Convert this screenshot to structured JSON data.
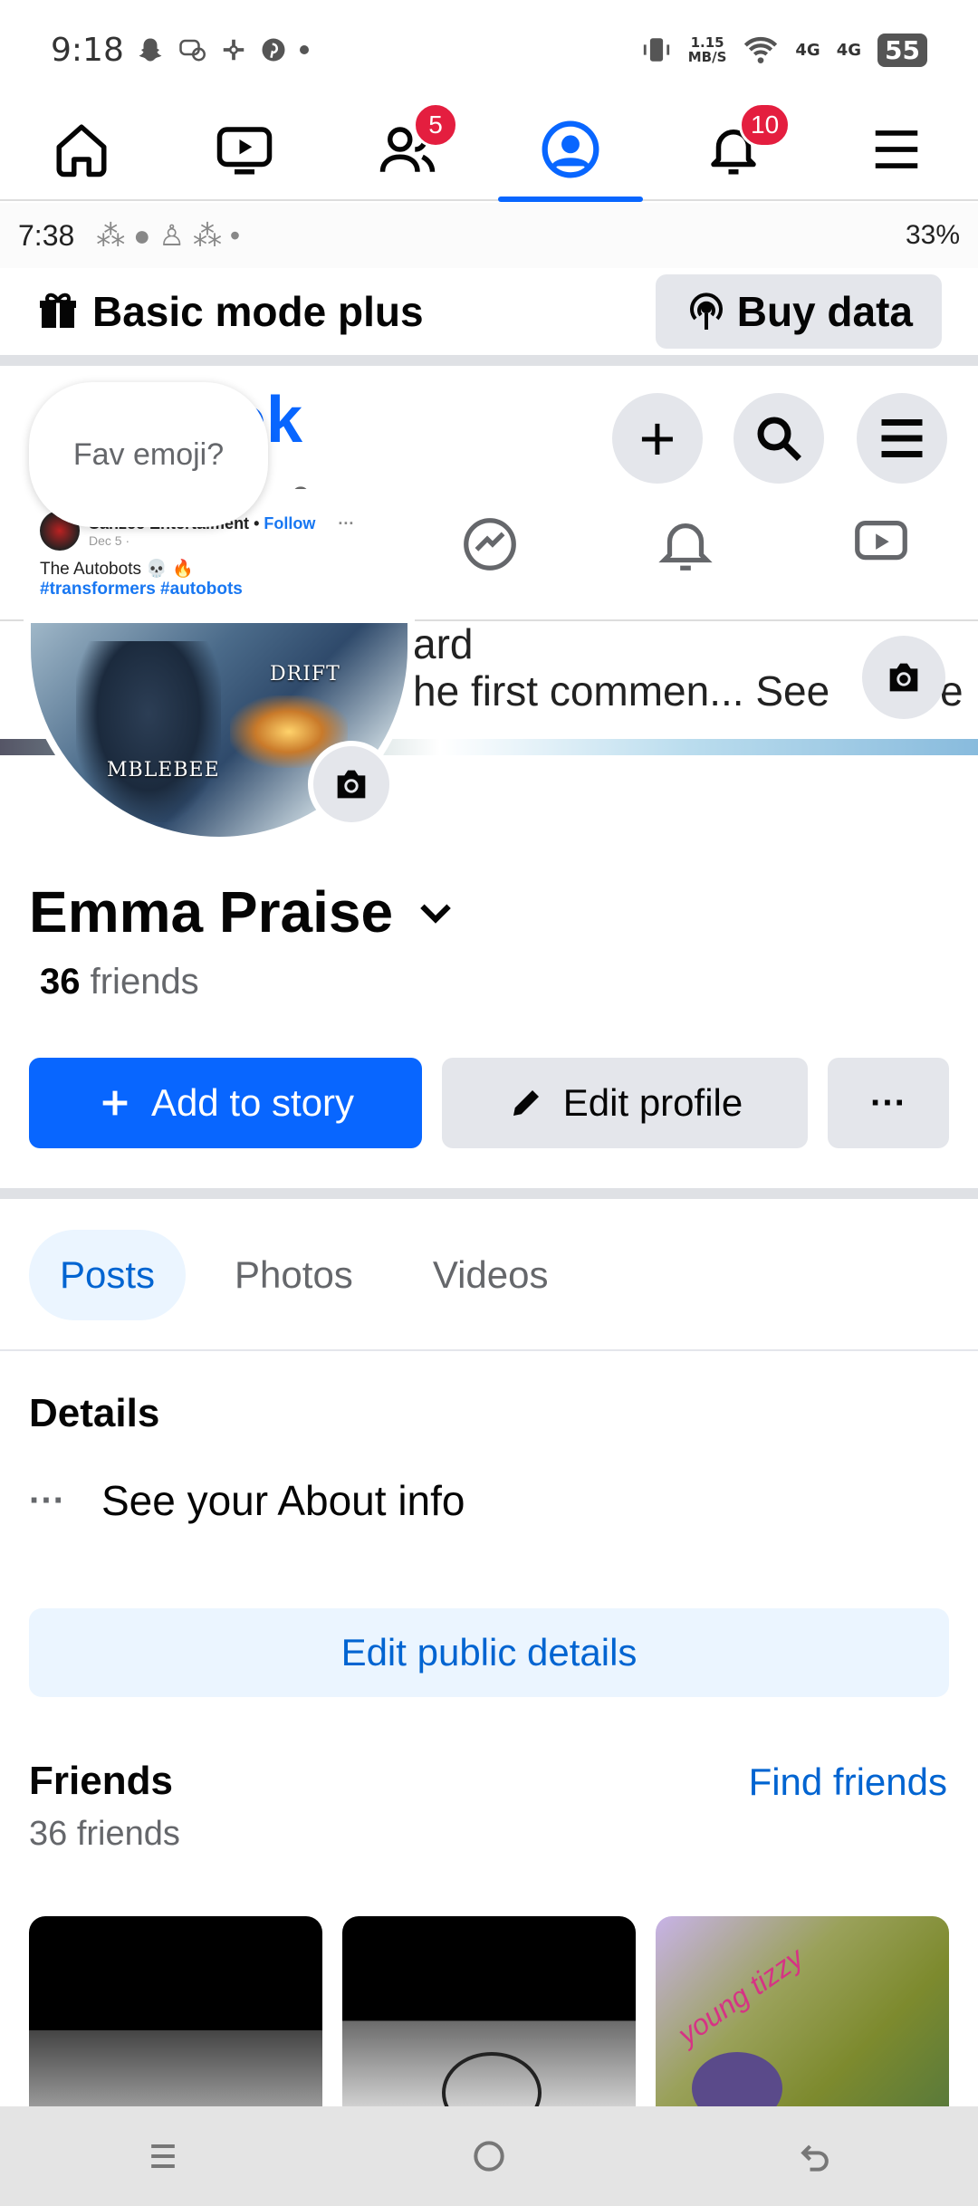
{
  "status_bar": {
    "time": "9:18",
    "net_speed": "1.15",
    "net_unit": "MB/S",
    "sig1": "4G",
    "sig2": "4G",
    "battery": "55"
  },
  "nav": {
    "items": [
      {
        "name": "home",
        "badge": ""
      },
      {
        "name": "video",
        "badge": ""
      },
      {
        "name": "friends",
        "badge": "5"
      },
      {
        "name": "profile",
        "badge": ""
      },
      {
        "name": "notifications",
        "badge": "10"
      },
      {
        "name": "menu",
        "badge": ""
      }
    ]
  },
  "story": {
    "inner_time": "7:38",
    "inner_battery": "33%",
    "basic_mode": "Basic mode plus",
    "buy_data": "Buy data",
    "logo_fragment": "ok",
    "bubble": "Fav emoji?",
    "post_author": "Sanzee Entertaiment",
    "post_follow": "Follow",
    "post_date": "Dec 5 ·",
    "post_text": "The Autobots 💀 🔥",
    "post_tags": "#transformers #autobots",
    "art_label1": "DRIFT",
    "art_label2": "MBLEBEE",
    "cover_line1": "ard",
    "cover_line2": "he first commen... See",
    "cover_tail": "e"
  },
  "profile": {
    "name": "Emma Praise",
    "friends_count": "36",
    "friends_label": "friends"
  },
  "actions": {
    "add_story": "Add to story",
    "edit_profile": "Edit profile",
    "more": "···"
  },
  "tabs": [
    "Posts",
    "Photos",
    "Videos"
  ],
  "details": {
    "title": "Details",
    "about": "See your About info",
    "edit_public": "Edit public details"
  },
  "friends": {
    "title": "Friends",
    "find": "Find friends",
    "count_text": "36 friends",
    "thumb3_text": "young tizzy"
  }
}
